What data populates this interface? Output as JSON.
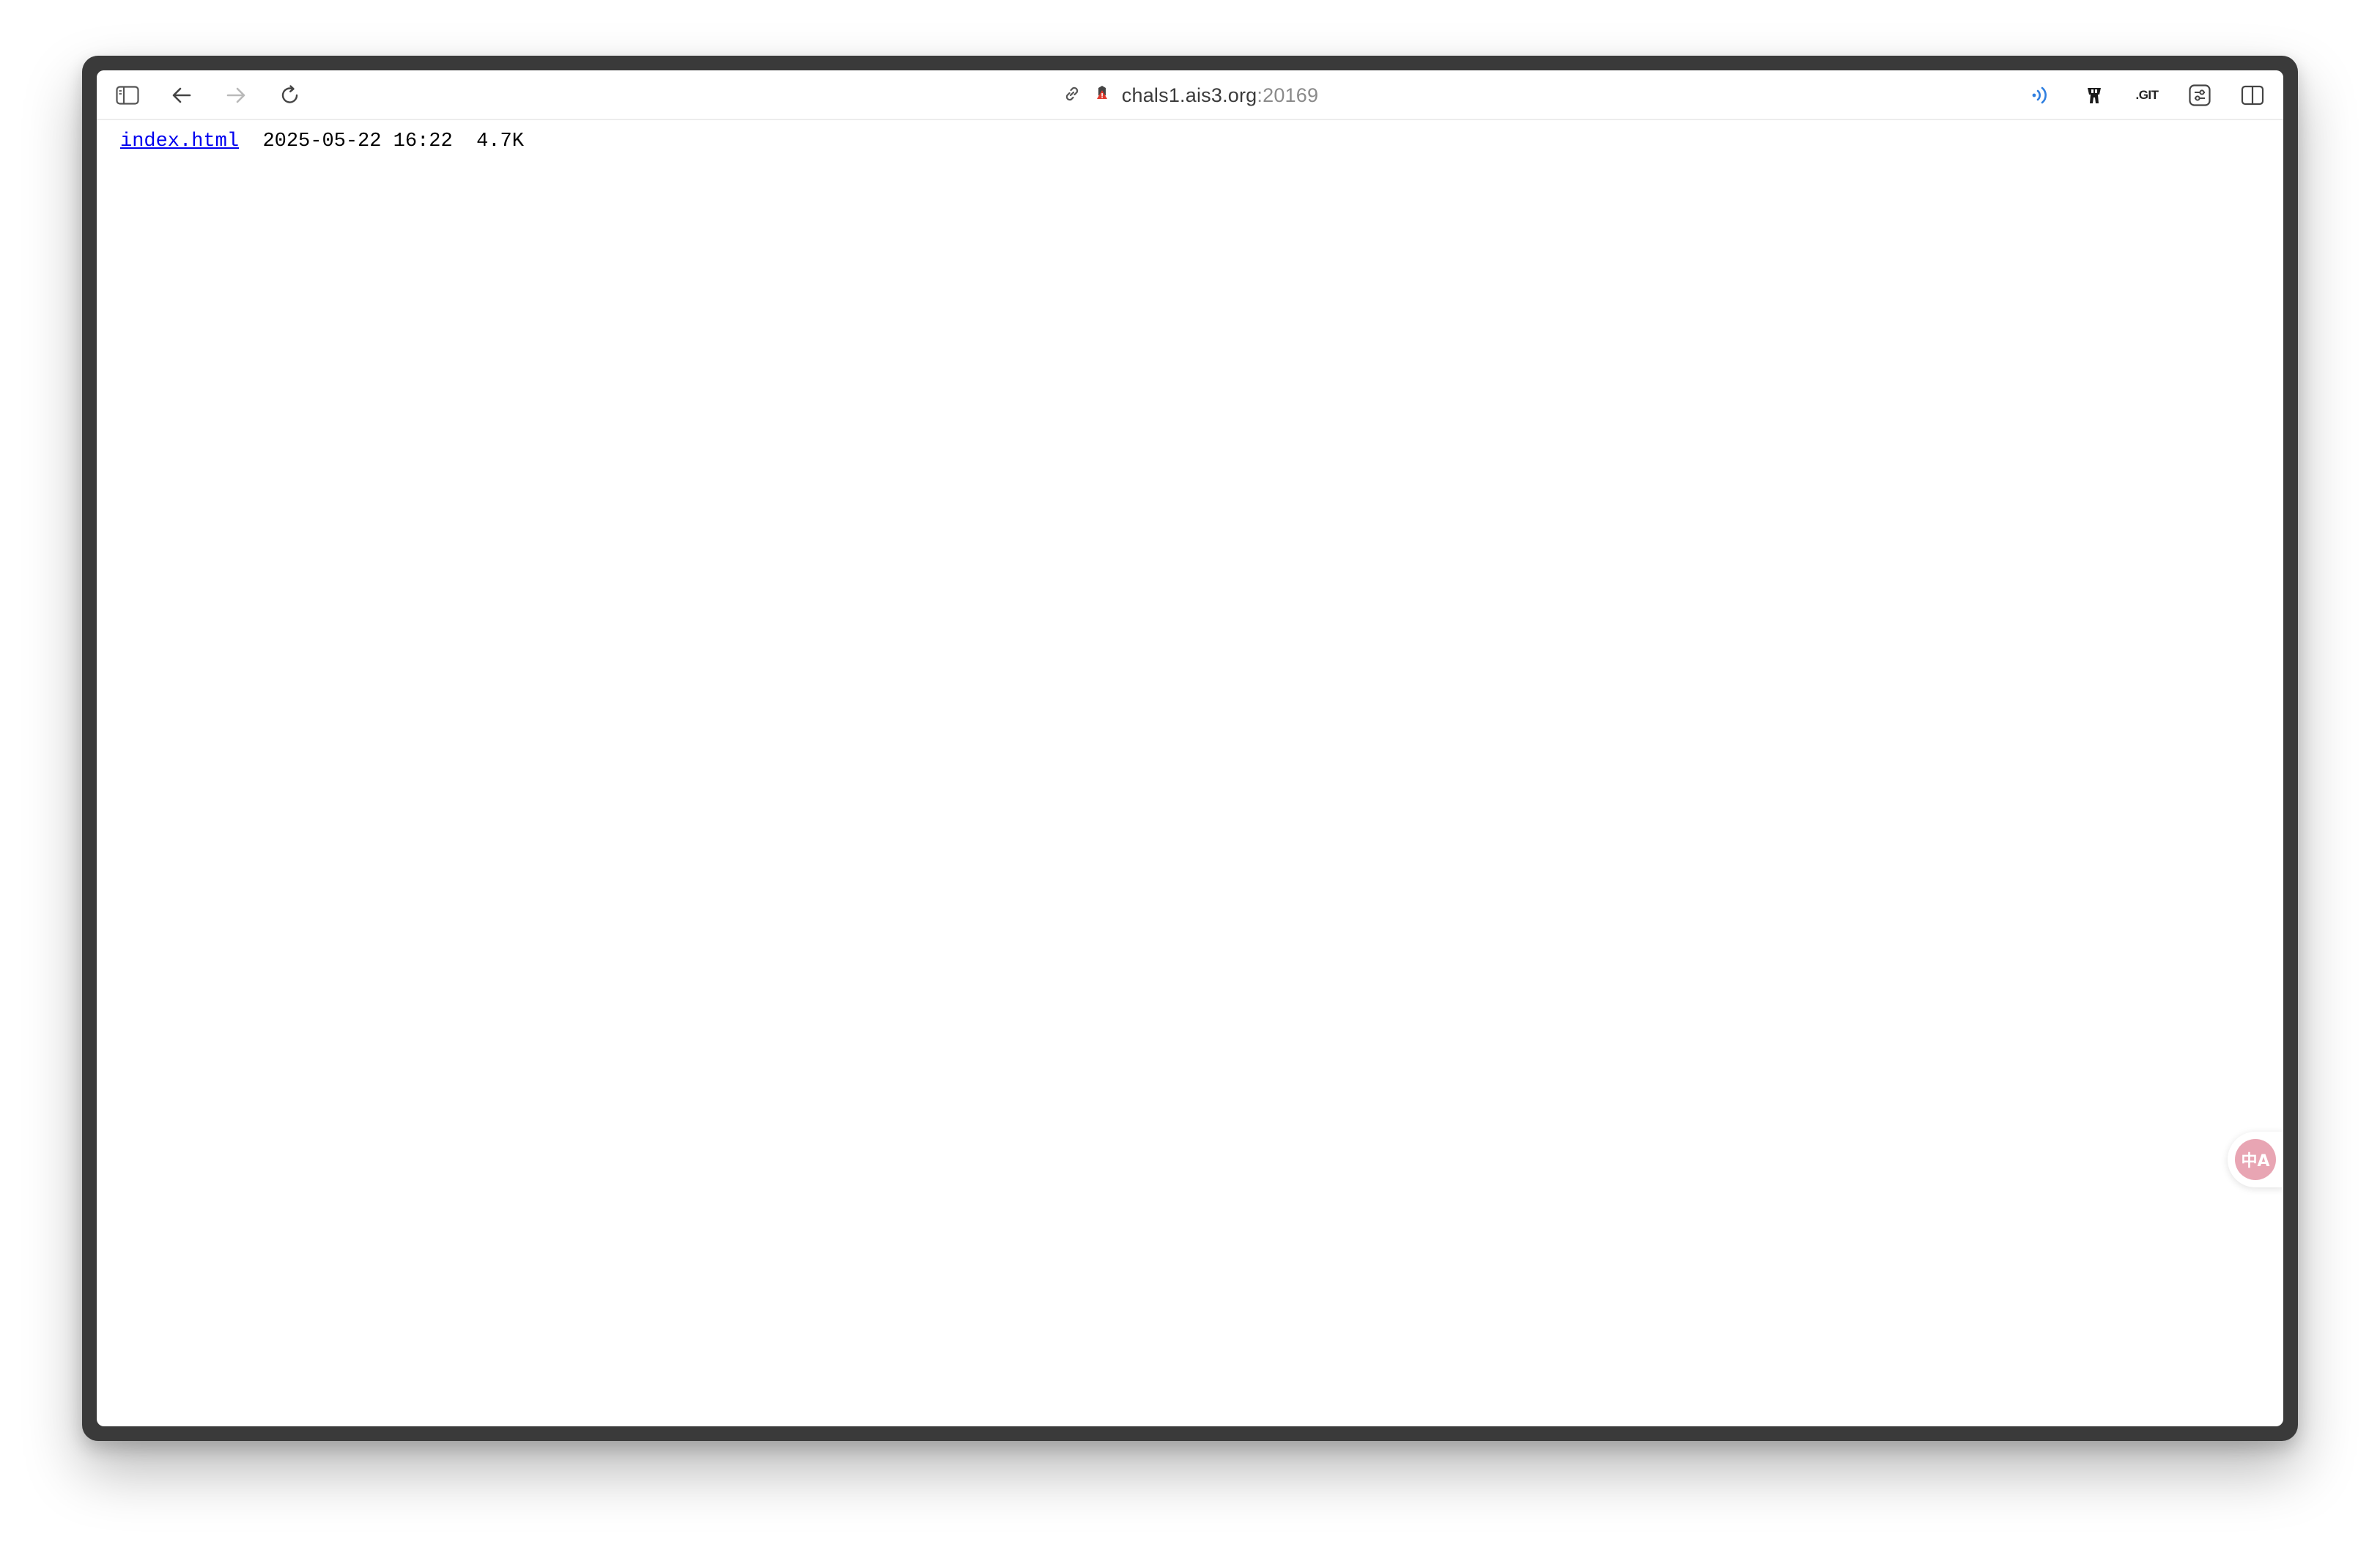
{
  "browser": {
    "address": {
      "host": "chals1.ais3.org",
      "port": ":20169"
    },
    "toolbar": {
      "icons": [
        "sidebar-icon",
        "back-arrow-icon",
        "forward-arrow-icon",
        "reload-icon",
        "link-icon",
        "privacy-report-icon",
        "reader-audio-icon",
        "extension-icon",
        "git-extension-icon",
        "settings-icon",
        "split-view-icon"
      ],
      "git_extension_label": ".GIT"
    }
  },
  "listing": {
    "entries": [
      {
        "name": "index.html",
        "date": "2025-05-22 16:22",
        "size": "4.7K"
      }
    ]
  },
  "translate_fab": {
    "glyph": "中A",
    "color": "#e8a5b3"
  }
}
